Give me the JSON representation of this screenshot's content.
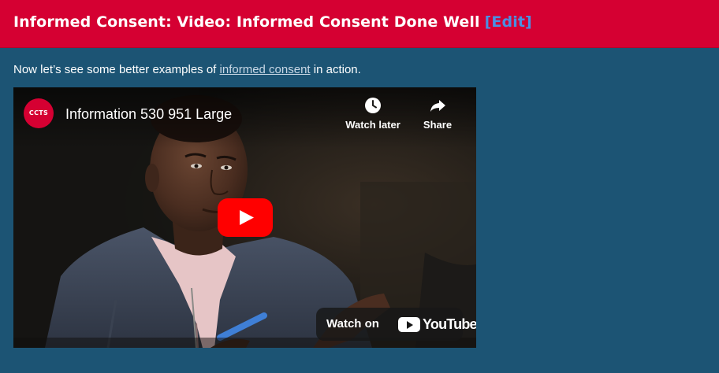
{
  "header": {
    "title": "Informed Consent: Video: Informed Consent Done Well",
    "edit_label": "[Edit]",
    "background_color": "#d50032",
    "edit_color": "#4a90e2"
  },
  "intro": {
    "before": "Now let’s see some better examples of ",
    "link_text": "informed consent",
    "after": " in action."
  },
  "video": {
    "channel_logo_text": "CCTS",
    "title": "Information 530 951 Large",
    "watch_later_label": "Watch later",
    "watch_later_icon": "clock-icon",
    "share_label": "Share",
    "share_icon": "share-arrow-icon",
    "play_icon": "youtube-play-icon",
    "watch_on_label": "Watch on",
    "watch_on_brand": "YouTube"
  },
  "colors": {
    "page_background": "#1c5474",
    "youtube_red": "#ff0000"
  }
}
